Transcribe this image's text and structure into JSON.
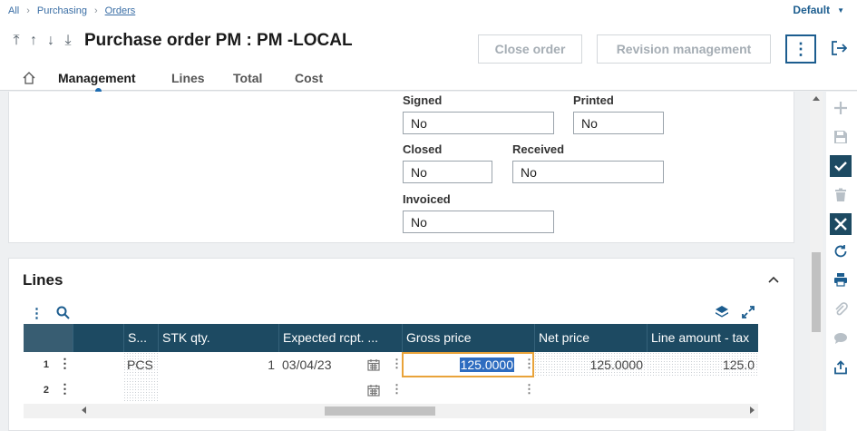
{
  "breadcrumb": {
    "items": [
      "All",
      "Purchasing",
      "Orders"
    ]
  },
  "user_menu": {
    "label": "Default"
  },
  "header": {
    "title": "Purchase order PM : PM -LOCAL",
    "close_order_label": "Close order",
    "revision_label": "Revision management"
  },
  "tabs": [
    {
      "label": "Management",
      "active": true
    },
    {
      "label": "Lines"
    },
    {
      "label": "Total"
    },
    {
      "label": "Cost"
    }
  ],
  "status_fields": {
    "signed": {
      "label": "Signed",
      "value": "No"
    },
    "printed": {
      "label": "Printed",
      "value": "No"
    },
    "closed": {
      "label": "Closed",
      "value": "No"
    },
    "received": {
      "label": "Received",
      "value": "No"
    },
    "invoiced": {
      "label": "Invoiced",
      "value": "No"
    }
  },
  "lines_section": {
    "title": "Lines",
    "columns": [
      "S...",
      "STK qty.",
      "Expected rcpt. ...",
      "Gross price",
      "Net price",
      "Line amount - tax"
    ],
    "rows": [
      {
        "num": "1",
        "unit": "PCS",
        "stk_qty": "1",
        "expected": "03/04/23",
        "gross": "125.0000",
        "net": "125.0000",
        "amount": "125.0"
      },
      {
        "num": "2",
        "unit": "",
        "stk_qty": "",
        "expected": "",
        "gross": "",
        "net": "",
        "amount": ""
      }
    ]
  },
  "icons": {
    "nav": [
      "first-icon",
      "previous-icon",
      "next-icon",
      "last-icon"
    ],
    "rail": [
      "plus-icon",
      "save-icon",
      "check-icon",
      "delete-icon",
      "close-icon",
      "refresh-icon",
      "print-icon",
      "attachment-icon",
      "comment-icon",
      "share-icon"
    ]
  },
  "colors": {
    "accent": "#1c5d8f",
    "grid_header": "#1d4a62",
    "focus": "#e9a33a"
  }
}
